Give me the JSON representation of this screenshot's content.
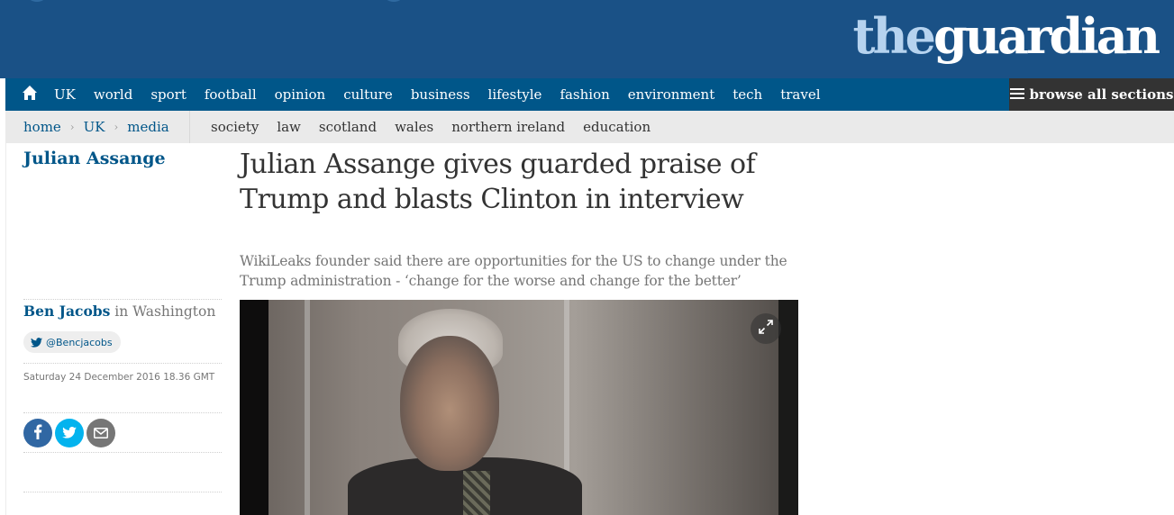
{
  "brand": {
    "logo_part1": "the",
    "logo_part2": "guardian",
    "header_bg": "#1a5186",
    "nav_bg": "#005689",
    "accent": "#005689"
  },
  "nav_primary": {
    "home_icon": "home-icon",
    "items": [
      "UK",
      "world",
      "sport",
      "football",
      "opinion",
      "culture",
      "business",
      "lifestyle",
      "fashion",
      "environment",
      "tech",
      "travel"
    ],
    "browse_label": "browse all sections",
    "browse_icon": "hamburger-menu-icon"
  },
  "nav_sub": {
    "breadcrumb": [
      "home",
      "UK",
      "media"
    ],
    "breadcrumb_separator": "›",
    "items": [
      "society",
      "law",
      "scotland",
      "wales",
      "northern ireland",
      "education"
    ]
  },
  "article": {
    "section": "Julian Assange",
    "headline": "Julian Assange gives guarded praise of Trump and blasts Clinton in interview",
    "standfirst": "WikiLeaks founder said there are opportunities for the US to change under the Trump administration - ‘change for the worse and change for the better’",
    "author": "Ben Jacobs",
    "author_location": " in Washington",
    "twitter_handle": "@Bencjacobs",
    "dateline": "Saturday 24 December 2016 18.36 GMT"
  },
  "share": {
    "facebook_icon": "facebook-icon",
    "twitter_icon": "twitter-icon",
    "email_icon": "email-icon",
    "facebook_color": "#3067a3",
    "twitter_color": "#03b3ee",
    "email_color": "#767676"
  },
  "media": {
    "expand_icon": "expand-icon"
  }
}
